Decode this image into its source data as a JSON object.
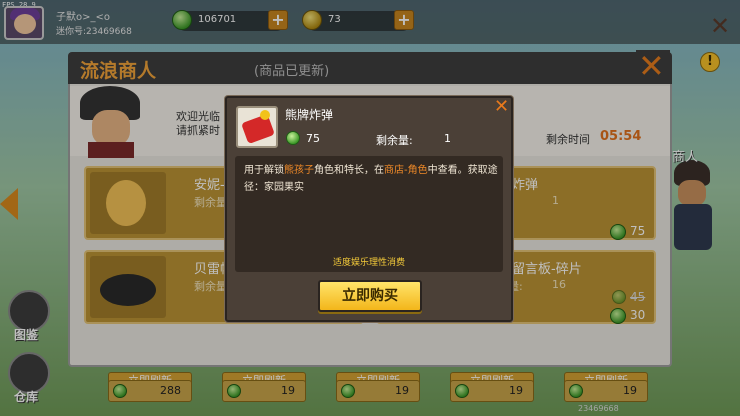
{
  "hud": {
    "fps": "FPS 28.9",
    "player_name": "子默o>_<o",
    "player_id": "迷你号:23469668",
    "green_currency": "106701",
    "gold_currency": "73"
  },
  "panel": {
    "title": "流浪商人",
    "subtitle": "(商品已更新)",
    "welcome_line1": "欢迎光临",
    "welcome_line2": "请抓紧时",
    "timer_label": "剩余时间",
    "timer_value": "05:54",
    "npc_name": "商人"
  },
  "cards": [
    {
      "name": "安妮-",
      "sub": "剩余量",
      "price": ""
    },
    {
      "name": "炸弹",
      "sub": "1",
      "price": "75"
    },
    {
      "name": "贝雷帽",
      "sub": "剩余量",
      "price": ""
    },
    {
      "name": "留言板-碎片",
      "sub_label": "剩余量:",
      "sub": "16",
      "old_price": "45",
      "price": "30"
    }
  ],
  "bottom": {
    "buttons": [
      "立即刷新",
      "立即刷新",
      "立即刷新",
      "立即刷新",
      "立即刷新"
    ],
    "prices": [
      "288",
      "19",
      "19",
      "19",
      "19"
    ],
    "id_text": "23469668"
  },
  "side": {
    "handbook": "图鉴",
    "storage": "仓库"
  },
  "popup": {
    "item_name": "熊牌炸弹",
    "price": "75",
    "stock_label": "剩余量:",
    "stock": "1",
    "desc_part1": "用于解锁",
    "desc_hl1": "熊孩子",
    "desc_part2": "角色和特长，在",
    "desc_hl2": "商店-角色",
    "desc_part3": "中查看。获取途径：家园果实",
    "notice": "适度娱乐理性消费",
    "buy_label": "立即购买"
  },
  "colors": {
    "accent_orange": "#e0701c",
    "gem_green": "#3f9a2a",
    "buy_yellow": "#f3b61a"
  }
}
